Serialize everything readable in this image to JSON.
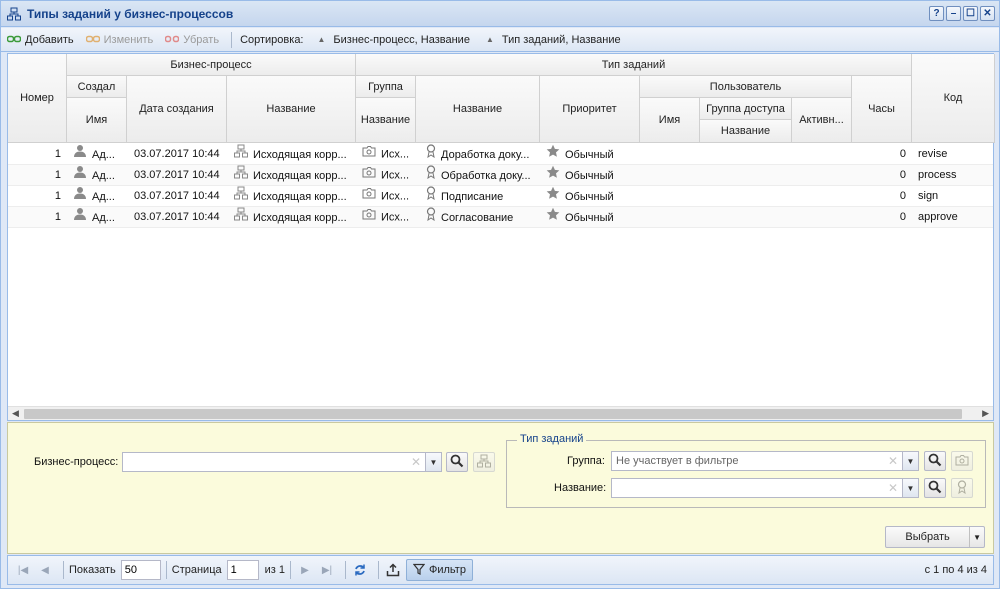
{
  "window": {
    "title": "Типы заданий у бизнес-процессов",
    "buttons": [
      "?",
      "–",
      "☐",
      "✕"
    ]
  },
  "toolbar": {
    "add_label": "Добавить",
    "edit_label": "Изменить",
    "remove_label": "Убрать",
    "sort_label": "Сортировка:",
    "sort_items": [
      "Бизнес-процесс, Название",
      "Тип заданий, Название"
    ]
  },
  "headers": {
    "number": "Номер",
    "business_process": "Бизнес-процесс",
    "created_by": "Создал",
    "name": "Имя",
    "created_date": "Дата создания",
    "bp_name": "Название",
    "task_type": "Тип заданий",
    "group": "Группа",
    "group_name": "Название",
    "tt_name": "Название",
    "priority": "Приоритет",
    "user": "Пользователь",
    "user_name": "Имя",
    "access_group": "Группа доступа",
    "access_group_name": "Название",
    "active": "Активн...",
    "hours": "Часы",
    "code": "Код"
  },
  "rows": [
    {
      "number": "1",
      "creator": "Ад...",
      "date": "03.07.2017 10:44",
      "bp_name": "Исходящая корр...",
      "group": "Исх...",
      "task": "Доработка доку...",
      "priority": "Обычный",
      "hours": "0",
      "code": "revise"
    },
    {
      "number": "1",
      "creator": "Ад...",
      "date": "03.07.2017 10:44",
      "bp_name": "Исходящая корр...",
      "group": "Исх...",
      "task": "Обработка доку...",
      "priority": "Обычный",
      "hours": "0",
      "code": "process"
    },
    {
      "number": "1",
      "creator": "Ад...",
      "date": "03.07.2017 10:44",
      "bp_name": "Исходящая корр...",
      "group": "Исх...",
      "task": "Подписание",
      "priority": "Обычный",
      "hours": "0",
      "code": "sign"
    },
    {
      "number": "1",
      "creator": "Ад...",
      "date": "03.07.2017 10:44",
      "bp_name": "Исходящая корр...",
      "group": "Исх...",
      "task": "Согласование",
      "priority": "Обычный",
      "hours": "0",
      "code": "approve"
    }
  ],
  "filter": {
    "bp_label": "Бизнес-процесс:",
    "bp_value": "",
    "task_type_legend": "Тип заданий",
    "group_label": "Группа:",
    "group_value": "Не участвует в фильтре",
    "name_label": "Название:",
    "name_value": "",
    "select_label": "Выбрать"
  },
  "paging": {
    "show_label": "Показать",
    "page_size": "50",
    "page_label": "Страница",
    "page_value": "1",
    "of_label": "из 1",
    "filter_label": "Фильтр",
    "info": "с 1 по 4 из 4"
  }
}
